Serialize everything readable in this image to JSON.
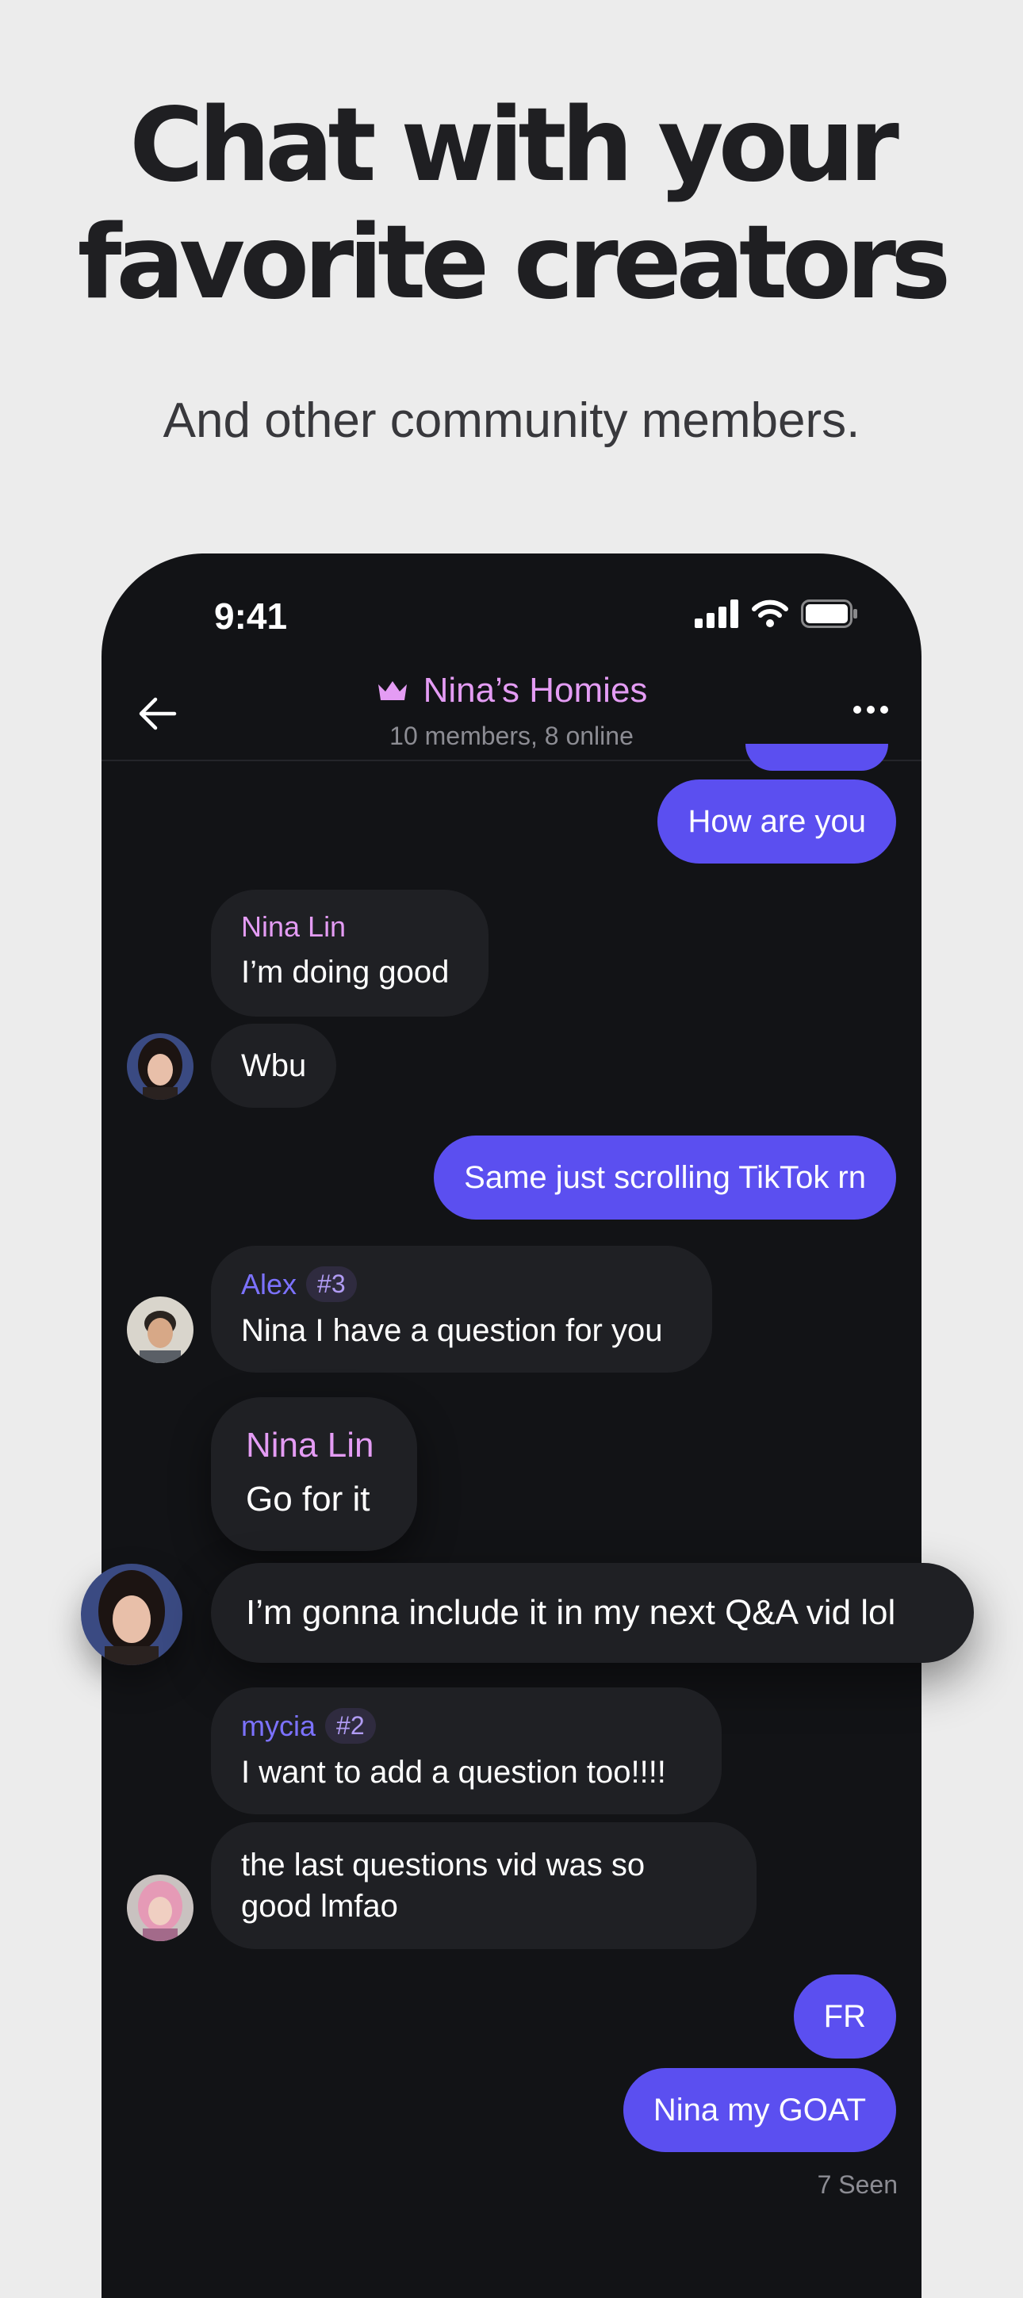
{
  "hero": {
    "headline_line1": "Chat with your",
    "headline_line2": "favorite creators",
    "subheadline": "And other community members."
  },
  "status_bar": {
    "time": "9:41"
  },
  "chat_header": {
    "group_name": "Nina’s Homies",
    "members_status": "10 members, 8 online"
  },
  "messages": {
    "out_1": "How are you",
    "nina_1_sender": "Nina Lin",
    "nina_1_text": "I’m doing good",
    "nina_2_text": "Wbu",
    "out_2": "Same just scrolling TikTok rn",
    "alex_sender": "Alex",
    "alex_badge": "#3",
    "alex_text": "Nina I have a question for you",
    "nina_3_sender": "Nina Lin",
    "nina_3_text": "Go for it",
    "nina_4_text": "I’m gonna include it in my next Q&A vid lol",
    "mycia_sender": "mycia",
    "mycia_badge": "#2",
    "mycia_text_1": "I want to add a question too!!!!",
    "mycia_text_2_line1": "the last questions vid was so",
    "mycia_text_2_line2": "good lmfao",
    "out_3": "FR",
    "out_4": "Nina my GOAT",
    "seen_status": "7 Seen"
  },
  "colors": {
    "background": "#ececec",
    "phone": "#121316",
    "outgoing_bubble": "#5b4ff0",
    "incoming_bubble": "#1f2024",
    "creator_name": "#e49cf4",
    "member_name": "#7c72ff"
  },
  "icons": [
    "signal-icon",
    "wifi-icon",
    "battery-icon",
    "back-arrow-icon",
    "crown-icon",
    "more-icon"
  ]
}
